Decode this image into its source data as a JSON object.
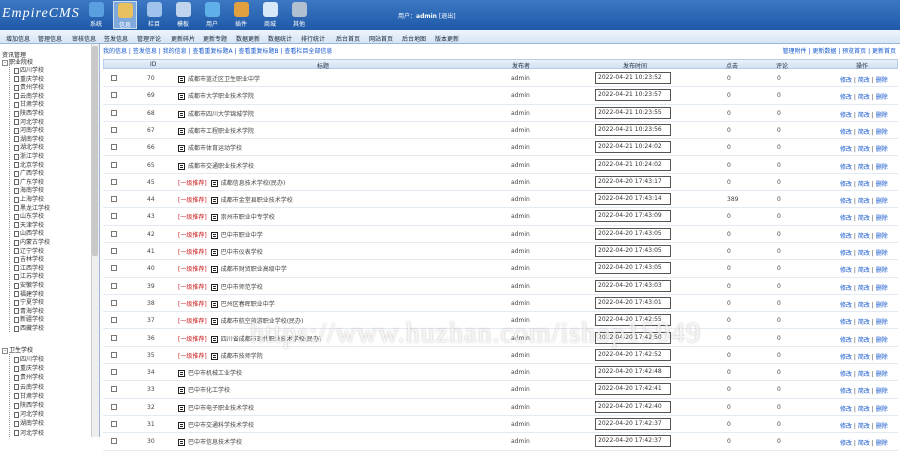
{
  "app": {
    "logo": "EmpireCMS"
  },
  "topmenu": [
    {
      "label": "系统",
      "color": "#5aa0e0"
    },
    {
      "label": "信息",
      "color": "#e8c060"
    },
    {
      "label": "栏目",
      "color": "#9fc3ec"
    },
    {
      "label": "模板",
      "color": "#c0d4ee"
    },
    {
      "label": "用户",
      "color": "#5fb0e8"
    },
    {
      "label": "插件",
      "color": "#e0a040"
    },
    {
      "label": "商城",
      "color": "#d8e8f8"
    },
    {
      "label": "其他",
      "color": "#b0c0d0"
    }
  ],
  "user": {
    "prefix": "用户：",
    "name": "admin",
    "logout": "[退出]"
  },
  "nav": [
    "增加信息",
    "管理信息",
    "审核信息",
    "签发信息",
    "管理评论",
    "更新碎片",
    "更新专题",
    "数据更新",
    "数据统计",
    "排行统计",
    "后台首页",
    "网站首页",
    "后台地图",
    "版本更新"
  ],
  "main": {
    "crumbs": "我的信息 | 签发信息 | 我的信息 | 查看重复标题A | 查看重复标题B | 查看栏目全部信息",
    "toolbar_right": "管理附件 | 更新数据 | 预览首页 | 更新首页"
  },
  "columns": {
    "id": "ID",
    "title": "标题",
    "publisher": "发布者",
    "time": "发布时间",
    "clicks": "点击",
    "comments": "评论",
    "ops": "操作"
  },
  "ops": {
    "edit": "修改",
    "simple": "简改",
    "del": "删除"
  },
  "sidebar": {
    "group1": {
      "title": "职业院校",
      "root": "资讯管理"
    },
    "provinces1": [
      "四川学校",
      "重庆学校",
      "贵州学校",
      "云南学校",
      "甘肃学校",
      "陕西学校",
      "河北学校",
      "河南学校",
      "湖南学校",
      "湖北学校",
      "浙江学校",
      "北京学校",
      "广西学校",
      "广东学校",
      "海南学校",
      "上海学校",
      "黑龙江学校",
      "山东学校",
      "天津学校",
      "山西学校",
      "内蒙古学校",
      "辽宁学校",
      "吉林学校",
      "江西学校",
      "江苏学校",
      "安徽学校",
      "福建学校",
      "宁夏学校",
      "青海学校",
      "新疆学校",
      "西藏学校"
    ],
    "group2": {
      "title": "卫生学校"
    },
    "provinces2": [
      "四川学校",
      "重庆学校",
      "贵州学校",
      "云南学校",
      "甘肃学校",
      "陕西学校",
      "河北学校",
      "湖南学校",
      "河北学校"
    ]
  },
  "rows": [
    {
      "id": "70",
      "sticky": "",
      "title": "成都市蓝迁区卫生职业中学",
      "publisher": "admin",
      "time": "2022-04-21 10:23:52",
      "clicks": "0",
      "comments": "0"
    },
    {
      "id": "69",
      "sticky": "",
      "title": "成都市大学职业技术学院",
      "publisher": "admin",
      "time": "2022-04-21 10:23:57",
      "clicks": "0",
      "comments": "0"
    },
    {
      "id": "68",
      "sticky": "",
      "title": "成都市四川大学锦城学院",
      "publisher": "admin",
      "time": "2022-04-21 10:23:55",
      "clicks": "0",
      "comments": "0"
    },
    {
      "id": "67",
      "sticky": "",
      "title": "成都市工程职业技术学院",
      "publisher": "admin",
      "time": "2022-04-21 10:23:56",
      "clicks": "0",
      "comments": "0"
    },
    {
      "id": "66",
      "sticky": "",
      "title": "成都市体育运动学校",
      "publisher": "admin",
      "time": "2022-04-21 10:24:02",
      "clicks": "0",
      "comments": "0"
    },
    {
      "id": "65",
      "sticky": "",
      "title": "成都市交通职业技术学校",
      "publisher": "admin",
      "time": "2022-04-21 10:24:02",
      "clicks": "0",
      "comments": "0"
    },
    {
      "id": "45",
      "sticky": "[一级推荐]",
      "title": "成都信息技术学校(民办)",
      "publisher": "admin",
      "time": "2022-04-20 17:43:17",
      "clicks": "0",
      "comments": "0"
    },
    {
      "id": "44",
      "sticky": "[一级推荐]",
      "title": "成都市金堂县职业技术学校",
      "publisher": "admin",
      "time": "2022-04-20 17:43:14",
      "clicks": "389",
      "comments": "0"
    },
    {
      "id": "43",
      "sticky": "[一级推荐]",
      "title": "崇州市职业中专学校",
      "publisher": "admin",
      "time": "2022-04-20 17:43:09",
      "clicks": "0",
      "comments": "0"
    },
    {
      "id": "42",
      "sticky": "[一级推荐]",
      "title": "巴中市职业中学",
      "publisher": "admin",
      "time": "2022-04-20 17:43:05",
      "clicks": "0",
      "comments": "0"
    },
    {
      "id": "41",
      "sticky": "[一级推荐]",
      "title": "巴中市仪表学校",
      "publisher": "admin",
      "time": "2022-04-20 17:43:05",
      "clicks": "0",
      "comments": "0"
    },
    {
      "id": "40",
      "sticky": "[一级推荐]",
      "title": "成都市财贸职业高级中学",
      "publisher": "admin",
      "time": "2022-04-20 17:43:05",
      "clicks": "0",
      "comments": "0"
    },
    {
      "id": "39",
      "sticky": "[一级推荐]",
      "title": "巴中市师范学校",
      "publisher": "admin",
      "time": "2022-04-20 17:43:03",
      "clicks": "0",
      "comments": "0"
    },
    {
      "id": "38",
      "sticky": "[一级推荐]",
      "title": "巴州区春晖职业中学",
      "publisher": "admin",
      "time": "2022-04-20 17:43:01",
      "clicks": "0",
      "comments": "0"
    },
    {
      "id": "37",
      "sticky": "[一级推荐]",
      "title": "成都市航空旅游职业学校(民办)",
      "publisher": "admin",
      "time": "2022-04-20 17:42:55",
      "clicks": "0",
      "comments": "0"
    },
    {
      "id": "36",
      "sticky": "[一级推荐]",
      "title": "四川省成都市现代职业技术学校(民办)",
      "publisher": "admin",
      "time": "2022-04-20 17:42:50",
      "clicks": "0",
      "comments": "0"
    },
    {
      "id": "35",
      "sticky": "[一级推荐]",
      "title": "成都市技师学院",
      "publisher": "admin",
      "time": "2022-04-20 17:42:52",
      "clicks": "0",
      "comments": "0"
    },
    {
      "id": "34",
      "sticky": "",
      "title": "巴中市机械工业学校",
      "publisher": "admin",
      "time": "2022-04-20 17:42:48",
      "clicks": "0",
      "comments": "0"
    },
    {
      "id": "33",
      "sticky": "",
      "title": "巴中市化工学校",
      "publisher": "admin",
      "time": "2022-04-20 17:42:41",
      "clicks": "0",
      "comments": "0"
    },
    {
      "id": "32",
      "sticky": "",
      "title": "巴中市电子职业技术学校",
      "publisher": "admin",
      "time": "2022-04-20 17:42:40",
      "clicks": "0",
      "comments": "0"
    },
    {
      "id": "31",
      "sticky": "",
      "title": "巴中市交通科学技术学校",
      "publisher": "admin",
      "time": "2022-04-20 17:42:37",
      "clicks": "0",
      "comments": "0"
    },
    {
      "id": "30",
      "sticky": "",
      "title": "巴中市信息技术学校",
      "publisher": "admin",
      "time": "2022-04-20 17:42:37",
      "clicks": "0",
      "comments": "0"
    }
  ],
  "watermark": "https://www.huzhan.com/ishop15949"
}
